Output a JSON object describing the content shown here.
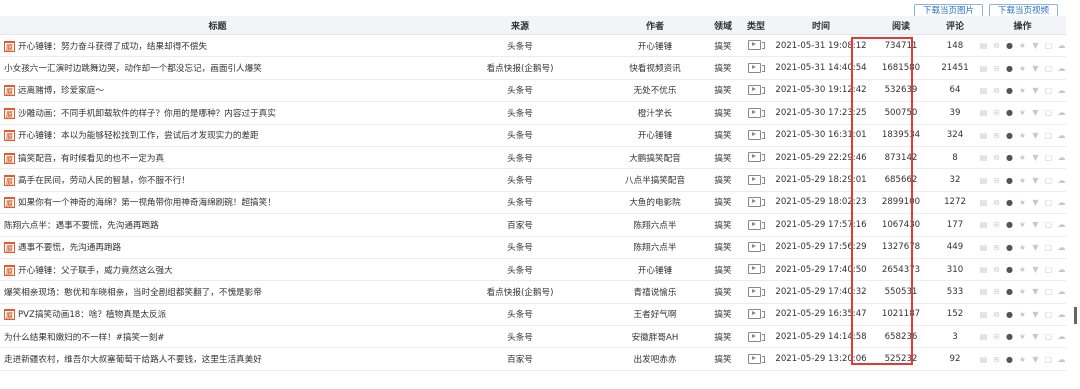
{
  "toolbar": {
    "download_images": "下载当页图片",
    "download_videos": "下载当页视频"
  },
  "columns": [
    "标题",
    "来源",
    "作者",
    "领域",
    "类型",
    "时间",
    "阅读",
    "评论",
    "操作"
  ],
  "rows": [
    {
      "badge": true,
      "title": "开心锤锤：努力奋斗获得了成功，结果却得不偿失",
      "source": "头条号",
      "author": "开心锤锤",
      "domain": "搞笑",
      "time": "2021-05-31 19:08:12",
      "reads": "734711",
      "comments": "148"
    },
    {
      "badge": false,
      "title": "小女孩六一汇演时边跳舞边哭，动作却一个都没忘记，画面引人爆笑",
      "source": "看点快报(企鹅号)",
      "author": "快看视频资讯",
      "domain": "搞笑",
      "time": "2021-05-31 14:40:54",
      "reads": "1681580",
      "comments": "21451"
    },
    {
      "badge": true,
      "title": "远离赌博，珍爱家庭～",
      "source": "头条号",
      "author": "无处不优乐",
      "domain": "搞笑",
      "time": "2021-05-30 19:12:42",
      "reads": "532639",
      "comments": "64"
    },
    {
      "badge": true,
      "title": "沙雕动画：不同手机卸载软件的样子？你用的是哪种？内容过于真实",
      "source": "头条号",
      "author": "橙汁学长",
      "domain": "搞笑",
      "time": "2021-05-30 17:23:25",
      "reads": "500750",
      "comments": "39"
    },
    {
      "badge": true,
      "title": "开心锤锤：本以为能够轻松找到工作，尝试后才发现实力的差距",
      "source": "头条号",
      "author": "开心锤锤",
      "domain": "搞笑",
      "time": "2021-05-30 16:31:01",
      "reads": "1839534",
      "comments": "324"
    },
    {
      "badge": true,
      "title": "搞笑配音，有时候看见的也不一定为真",
      "source": "头条号",
      "author": "大鹏搞笑配音",
      "domain": "搞笑",
      "time": "2021-05-29 22:29:46",
      "reads": "873142",
      "comments": "8"
    },
    {
      "badge": true,
      "title": "高手在民间，劳动人民的智慧，你不服不行！",
      "source": "头条号",
      "author": "八点半搞笑配音",
      "domain": "搞笑",
      "time": "2021-05-29 18:29:01",
      "reads": "685662",
      "comments": "32"
    },
    {
      "badge": true,
      "title": "如果你有一个神奇的海绵？第一视角带你用神奇海绵刷碗！超搞笑！",
      "source": "头条号",
      "author": "大鱼的电影院",
      "domain": "搞笑",
      "time": "2021-05-29 18:02:23",
      "reads": "2899100",
      "comments": "1272"
    },
    {
      "badge": false,
      "title": "陈翔六点半：遇事不要慌，先沟通再跑路",
      "source": "百家号",
      "author": "陈翔六点半",
      "domain": "搞笑",
      "time": "2021-05-29 17:57:16",
      "reads": "1067430",
      "comments": "177"
    },
    {
      "badge": true,
      "title": "遇事不要慌，先沟通再跑路",
      "source": "头条号",
      "author": "陈翔六点半",
      "domain": "搞笑",
      "time": "2021-05-29 17:56:29",
      "reads": "1327678",
      "comments": "449"
    },
    {
      "badge": true,
      "title": "开心锤锤：父子联手，威力竟然这么强大",
      "source": "头条号",
      "author": "开心锤锤",
      "domain": "搞笑",
      "time": "2021-05-29 17:40:50",
      "reads": "2654373",
      "comments": "310"
    },
    {
      "badge": false,
      "title": "爆笑相亲现场：憨优和车晓相亲，当时全剧组都笑翻了，不愧是影帝",
      "source": "看点快报(企鹅号)",
      "author": "青禧说愉乐",
      "domain": "搞笑",
      "time": "2021-05-29 17:40:32",
      "reads": "550531",
      "comments": "533"
    },
    {
      "badge": true,
      "title": "PVZ搞笑动画18：啥？植物真是太反派",
      "source": "头条号",
      "author": "王者好气啊",
      "domain": "搞笑",
      "time": "2021-05-29 16:35:47",
      "reads": "1021187",
      "comments": "152"
    },
    {
      "badge": false,
      "title": "为什么结果和嫩妇的不一样！#搞笑一刻#",
      "source": "头条号",
      "author": "安徽胖哥AH",
      "domain": "搞笑",
      "time": "2021-05-29 14:14:58",
      "reads": "658236",
      "comments": "3"
    },
    {
      "badge": false,
      "title": "走进新疆农村，维吾尔大叔塞葡萄干给路人不要钱，这里生活真美好",
      "source": "百家号",
      "author": "出发吧赤赤",
      "domain": "搞笑",
      "time": "2021-05-29 13:20:06",
      "reads": "525232",
      "comments": "92"
    }
  ],
  "badge_text": "原",
  "colors": {
    "highlight": "#e53935",
    "link": "#2f6fc8",
    "badge": "#e25c2a"
  }
}
